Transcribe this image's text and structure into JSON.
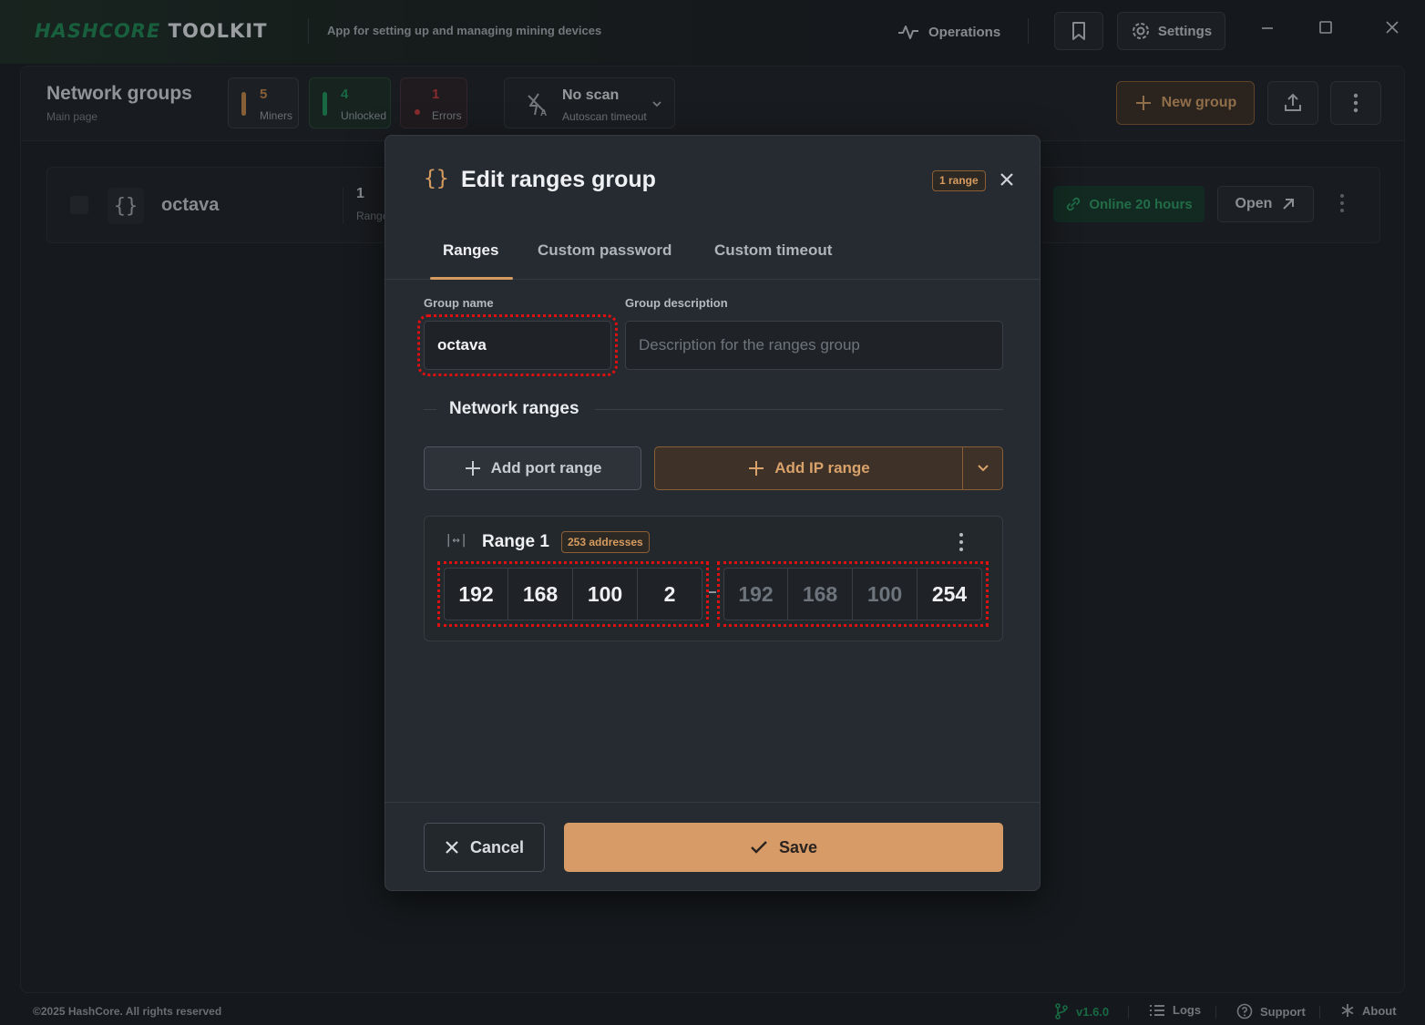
{
  "titlebar": {
    "brand_part1": "HASHCORE",
    "brand_part2": "TOOLKIT",
    "tagline": "App for setting up and managing mining devices",
    "operations_label": "Operations",
    "settings_label": "Settings"
  },
  "header": {
    "title": "Network groups",
    "subtitle": "Main page",
    "stats": [
      {
        "value": "5",
        "label": "Miners",
        "color": "#c98a4b"
      },
      {
        "value": "4",
        "label": "Unlocked",
        "color": "#1f9a5e"
      },
      {
        "value": "1",
        "label": "Errors",
        "color": "#c93c3c"
      }
    ],
    "scan": {
      "title": "No scan",
      "subtitle": "Autoscan timeout"
    },
    "new_group_label": "New group"
  },
  "group_row": {
    "name": "octava",
    "range_count": "1",
    "range_label": "Range",
    "status": "Online 20 hours",
    "open_label": "Open"
  },
  "modal": {
    "title": "Edit ranges group",
    "badge": "1 range",
    "tabs": [
      "Ranges",
      "Custom password",
      "Custom timeout"
    ],
    "active_tab": "Ranges",
    "group_name_label": "Group name",
    "group_name_value": "octava",
    "group_description_label": "Group description",
    "group_description_placeholder": "Description for the ranges group",
    "section_title": "Network ranges",
    "add_port_range_label": "Add port range",
    "add_ip_range_label": "Add IP range",
    "range": {
      "title": "Range 1",
      "addresses_badge": "253 addresses",
      "start": [
        "192",
        "168",
        "100",
        "2"
      ],
      "end_placeholder": [
        "192",
        "168",
        "100"
      ],
      "end_last": "254"
    },
    "cancel_label": "Cancel",
    "save_label": "Save"
  },
  "footer": {
    "copyright": "©2025 HashCore. All rights reserved",
    "version": "v1.6.0",
    "logs": "Logs",
    "support": "Support",
    "about": "About"
  },
  "colors": {
    "accent": "#d69b66",
    "brand_green": "#1f8a57",
    "online_green": "#2e9e66",
    "highlight": "#e01010"
  }
}
